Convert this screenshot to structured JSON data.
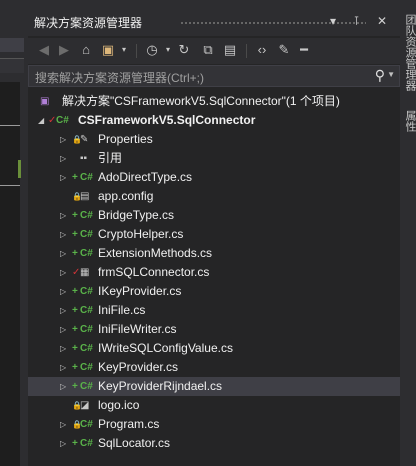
{
  "panel": {
    "title": "解决方案资源管理器",
    "title_buttons": "▾ ⊺ ✕"
  },
  "toolbar": {
    "icons": [
      "back-icon",
      "forward-icon",
      "home-icon",
      "switch-views-icon",
      "history-icon",
      "refresh-icon",
      "collapse-all-icon",
      "show-all-files-icon",
      "code-icon",
      "properties-wrench-icon",
      "preview-pin-icon"
    ]
  },
  "search": {
    "placeholder": "搜索解决方案资源管理器(Ctrl+;)"
  },
  "tree": {
    "solution": "解决方案\"CSFrameworkV5.SqlConnector\"(1 个项目)",
    "project": "CSFrameworkV5.SqlConnector",
    "items": [
      {
        "label": "Properties",
        "icon": "wrench-icon",
        "marker": "lock"
      },
      {
        "label": "引用",
        "icon": "references-icon",
        "marker": ""
      },
      {
        "label": "AdoDirectType.cs",
        "icon": "csharp-icon",
        "marker": "plus"
      },
      {
        "label": "app.config",
        "icon": "config-file-icon",
        "marker": "lock"
      },
      {
        "label": "BridgeType.cs",
        "icon": "csharp-icon",
        "marker": "plus"
      },
      {
        "label": "CryptoHelper.cs",
        "icon": "csharp-icon",
        "marker": "plus"
      },
      {
        "label": "ExtensionMethods.cs",
        "icon": "csharp-icon",
        "marker": "plus"
      },
      {
        "label": "frmSQLConnector.cs",
        "icon": "form-icon",
        "marker": "check"
      },
      {
        "label": "IKeyProvider.cs",
        "icon": "csharp-icon",
        "marker": "plus"
      },
      {
        "label": "IniFile.cs",
        "icon": "csharp-icon",
        "marker": "plus"
      },
      {
        "label": "IniFileWriter.cs",
        "icon": "csharp-icon",
        "marker": "plus"
      },
      {
        "label": "IWriteSQLConfigValue.cs",
        "icon": "csharp-icon",
        "marker": "plus"
      },
      {
        "label": "KeyProvider.cs",
        "icon": "csharp-icon",
        "marker": "plus"
      },
      {
        "label": "KeyProviderRijndael.cs",
        "icon": "csharp-icon",
        "marker": "plus"
      },
      {
        "label": "logo.ico",
        "icon": "icon-file-icon",
        "marker": "lock"
      },
      {
        "label": "Program.cs",
        "icon": "csharp-icon",
        "marker": "lock"
      },
      {
        "label": "SqlLocator.cs",
        "icon": "csharp-icon",
        "marker": "plus"
      }
    ],
    "selected_index": 13
  },
  "right_tabs": [
    "团队资源管理器",
    "属性"
  ],
  "colors": {
    "background": "#252526",
    "chrome": "#2d2d30",
    "selection": "#3f3f46",
    "csharp_icon": "#5ab34a",
    "lock_marker": "#3c9bd6",
    "check_marker": "#d13438"
  }
}
